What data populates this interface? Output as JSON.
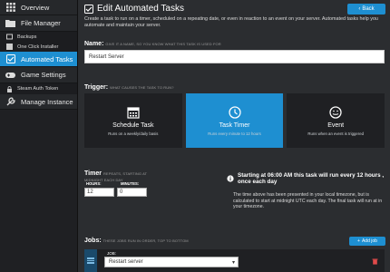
{
  "sidebar": {
    "items": [
      {
        "label": "Overview",
        "icon": "grid-icon"
      },
      {
        "label": "File Manager",
        "icon": "folder-icon"
      },
      {
        "label": "Backups",
        "icon": "backup-icon"
      },
      {
        "label": "One Click Installer",
        "icon": "installer-icon"
      },
      {
        "label": "Automated Tasks",
        "icon": "tasks-icon"
      },
      {
        "label": "Game Settings",
        "icon": "gamepad-icon"
      },
      {
        "label": "Steam Auth Token",
        "icon": "lock-icon"
      },
      {
        "label": "Manage Instance",
        "icon": "wrench-icon"
      }
    ]
  },
  "header": {
    "title": "Edit Automated Tasks",
    "back_label": "Back",
    "intro": "Create a task to run on a timer, scheduled on a repeating date, or even in reaction to an event on your server. Automated tasks help you automate and maintain your server."
  },
  "name_section": {
    "label": "Name:",
    "hint": "GIVE IT A NAME, SO YOU KNOW WHAT THIS TASK IS USED FOR",
    "value": "Restart Server"
  },
  "trigger_section": {
    "label": "Trigger:",
    "hint": "WHAT CAUSES THE TASK TO RUN?",
    "options": [
      {
        "title": "Schedule Task",
        "desc": "Runs on a weekly/daily basis"
      },
      {
        "title": "Task Timer",
        "desc": "Runs every minute to 12 hours"
      },
      {
        "title": "Event",
        "desc": "Runs when an event is triggered"
      }
    ]
  },
  "timer_section": {
    "label": "Timer",
    "hint": "REPEATS, STARTING AT MIDNIGHT EACH DAY",
    "hours_label": "HOURS:",
    "minutes_label": "MINUTES:",
    "hours_value": "12",
    "minutes_value": "0",
    "summary": "Starting at 06:00 AM this task will run every 12 hours , once each day",
    "description": "The time above has been presented in your local timezone, but is calculated to start at midnight UTC each day. The final task will run at in your timezone."
  },
  "jobs_section": {
    "label": "Jobs:",
    "hint": "THESE JOBS RUN IN ORDER, TOP TO BOTTOM",
    "add_label": "Add job",
    "job_field_label": "JOB:",
    "job_value": "Restart server"
  },
  "colors": {
    "accent": "#1e8fd1",
    "sidebar_bg": "#1f2023",
    "main_bg": "#2b2d30"
  }
}
